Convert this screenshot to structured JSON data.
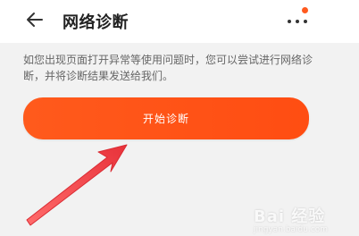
{
  "header": {
    "title": "网络诊断",
    "back_icon": "arrow-left-icon",
    "more_icon": "more-dots-icon",
    "notification_color": "#ff5a1f"
  },
  "main": {
    "description": "如您出现页面打开异常等使用问题时，您可以尝试进行网络诊断，并将诊断结果发送给我们。",
    "start_button_label": "开始诊断",
    "accent_color": "#ff4d12"
  },
  "overlay": {
    "annotation": "red-arrow-icon",
    "arrow_color": "#e8323a",
    "watermark_text": "Bai 经验",
    "watermark_url": "jingyan.baidu.com"
  }
}
